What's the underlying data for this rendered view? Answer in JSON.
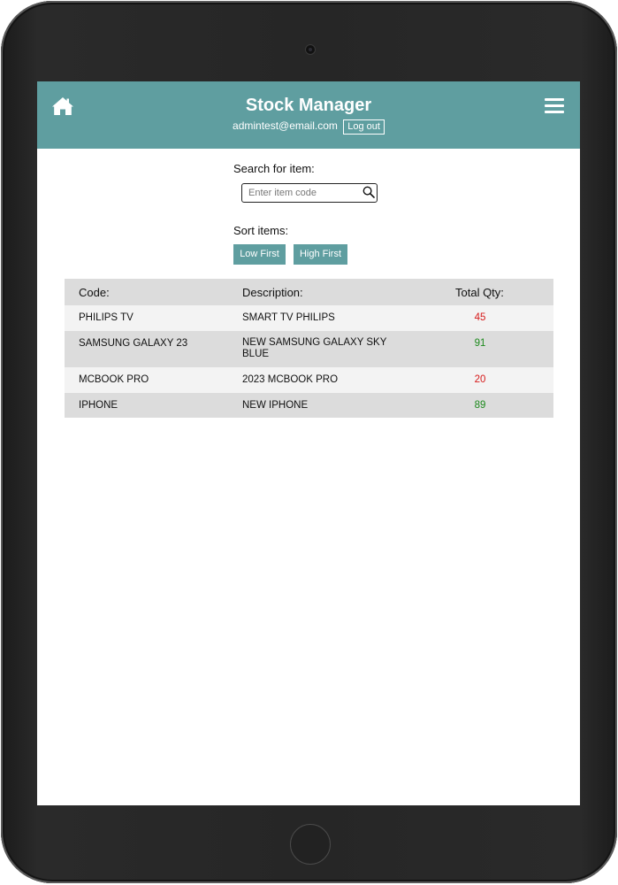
{
  "header": {
    "title": "Stock Manager",
    "user_email": "admintest@email.com",
    "logout_label": "Log out"
  },
  "search": {
    "label": "Search for item:",
    "placeholder": "Enter item code"
  },
  "sort": {
    "label": "Sort items:",
    "low_first": "Low First",
    "high_first": "High First"
  },
  "table": {
    "columns": [
      "Code:",
      "Description:",
      "Total Qty:"
    ],
    "rows": [
      {
        "code": "PHILIPS TV",
        "description": "SMART TV PHILIPS",
        "qty": "45",
        "status": "low"
      },
      {
        "code": "SAMSUNG GALAXY 23",
        "description": "NEW SAMSUNG GALAXY SKY BLUE",
        "qty": "91",
        "status": "high"
      },
      {
        "code": "MCBOOK PRO",
        "description": "2023 MCBOOK PRO",
        "qty": "20",
        "status": "low"
      },
      {
        "code": "IPHONE",
        "description": "NEW IPHONE",
        "qty": "89",
        "status": "high"
      }
    ]
  },
  "colors": {
    "accent": "#5f9ea0",
    "qty_low": "#d61a1a",
    "qty_high": "#1d8a1d"
  },
  "icons": {
    "home": "home-icon",
    "menu": "hamburger-menu-icon",
    "search": "search-icon"
  }
}
